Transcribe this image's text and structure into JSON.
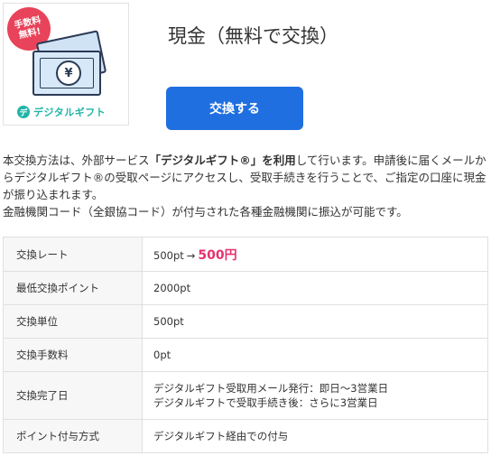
{
  "logo": {
    "badge_line1": "手数料",
    "badge_line2": "無料!",
    "yen_symbol": "¥",
    "brand_mark": "デ",
    "brand_name": "デジタルギフト"
  },
  "header": {
    "title": "現金（無料で交換）",
    "exchange_button_label": "交換する"
  },
  "description": {
    "part1": "本交換方法は、外部サービス",
    "bold": "「デジタルギフト®」を利用",
    "part2": "して行います。申請後に届くメールからデジタルギフト®の受取ページにアクセスし、受取手続きを行うことで、ご指定の口座に現金が振り込まれます。",
    "line2": "金融機関コード（全銀協コード）が付与された各種金融機関に振込が可能です。"
  },
  "table": {
    "rate_label": "交換レート",
    "rate_from": "500pt",
    "rate_arrow": "→",
    "rate_to": "500円",
    "min_label": "最低交換ポイント",
    "min_value": "2000pt",
    "unit_label": "交換単位",
    "unit_value": "500pt",
    "fee_label": "交換手数料",
    "fee_value": "0pt",
    "completion_label": "交換完了日",
    "completion_line1": "デジタルギフト受取用メール発行：即日〜3営業日",
    "completion_line2": "デジタルギフトで受取手続き後：さらに3営業日",
    "grant_label": "ポイント付与方式",
    "grant_value": "デジタルギフト経由での付与"
  },
  "colors": {
    "button_blue": "#1f6fe0",
    "rate_pink": "#e6316f",
    "badge_red": "#e8435a",
    "brand_teal": "#1fb5a7"
  },
  "icons": {
    "badge": "free-fee-badge",
    "money": "banknote-icon",
    "brand": "digital-gift-logo"
  }
}
